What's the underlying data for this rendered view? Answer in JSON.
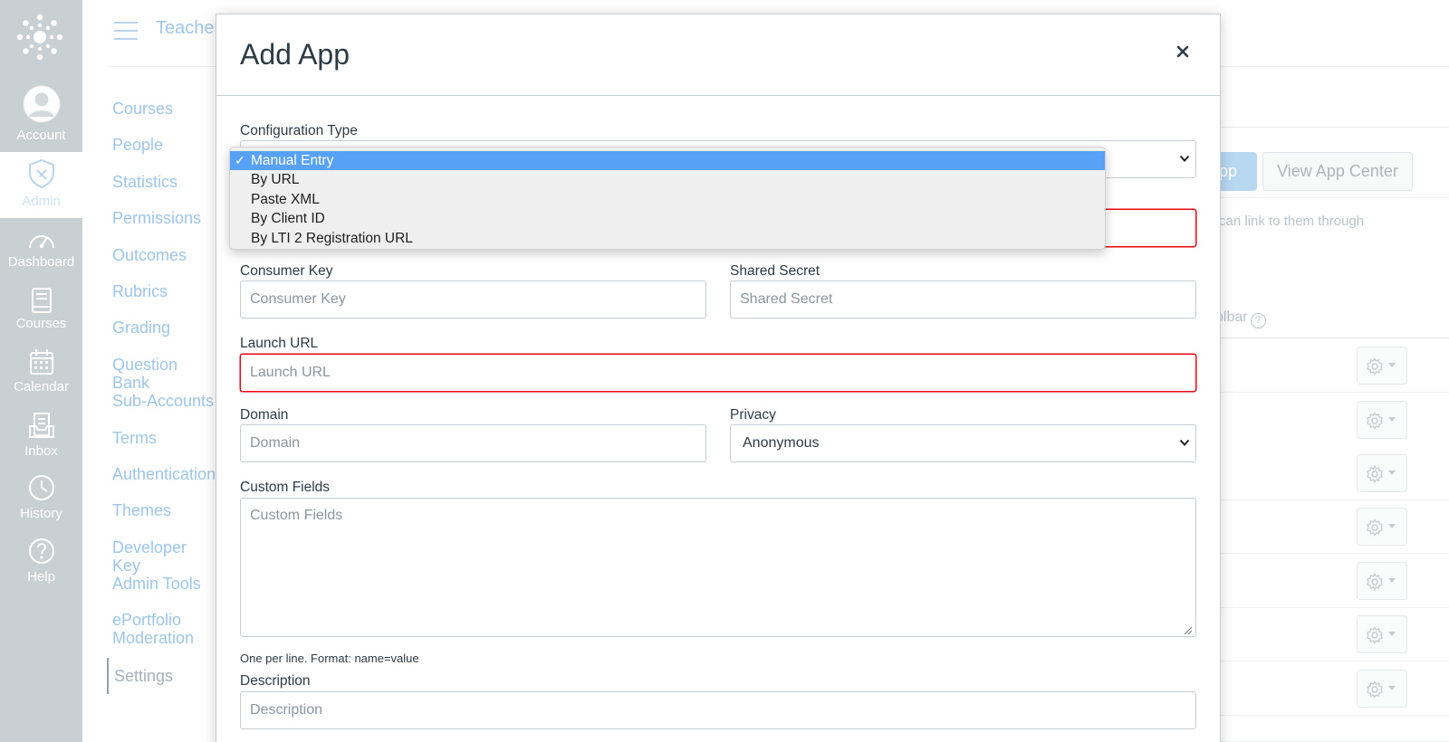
{
  "global_nav": {
    "items": [
      {
        "label": "Account",
        "icon": "account-icon"
      },
      {
        "label": "Admin",
        "icon": "admin-icon",
        "active": true
      },
      {
        "label": "Dashboard",
        "icon": "dashboard-icon"
      },
      {
        "label": "Courses",
        "icon": "courses-icon"
      },
      {
        "label": "Calendar",
        "icon": "calendar-icon"
      },
      {
        "label": "Inbox",
        "icon": "inbox-icon"
      },
      {
        "label": "History",
        "icon": "history-icon"
      },
      {
        "label": "Help",
        "icon": "help-icon"
      }
    ]
  },
  "background": {
    "breadcrumb": "Teacher",
    "sub_nav": [
      "Courses",
      "People",
      "Statistics",
      "Permissions",
      "Outcomes",
      "Rubrics",
      "Grading",
      "Question Bank",
      "Sub-Accounts",
      "Terms",
      "Authentication",
      "Themes",
      "Developer Key",
      "Admin Tools",
      "ePortfolio Moderation"
    ],
    "sub_nav_current": "Settings",
    "add_app_button": "pp",
    "view_app_center_button": "View App Center",
    "hint_text": "can link to them through",
    "toolbar_label": "olbar",
    "help_glyph": "?"
  },
  "modal": {
    "title": "Add App",
    "close_glyph": "×",
    "configuration_type": {
      "label": "Configuration Type",
      "selected": "Manual Entry",
      "options": [
        "Manual Entry",
        "By URL",
        "Paste XML",
        "By Client ID",
        "By LTI 2 Registration URL"
      ],
      "check_glyph": "✓"
    },
    "consumer_key": {
      "label": "Consumer Key",
      "placeholder": "Consumer Key"
    },
    "shared_secret": {
      "label": "Shared Secret",
      "placeholder": "Shared Secret"
    },
    "launch_url": {
      "label": "Launch URL",
      "placeholder": "Launch URL"
    },
    "domain": {
      "label": "Domain",
      "placeholder": "Domain"
    },
    "privacy": {
      "label": "Privacy",
      "value": "Anonymous"
    },
    "custom_fields": {
      "label": "Custom Fields",
      "placeholder": "Custom Fields",
      "help": "One per line. Format: name=value"
    },
    "description": {
      "label": "Description",
      "placeholder": "Description"
    }
  },
  "colors": {
    "accent": "#57a1f6",
    "error": "#ee0612",
    "nav_bg": "#c9d0d4"
  }
}
